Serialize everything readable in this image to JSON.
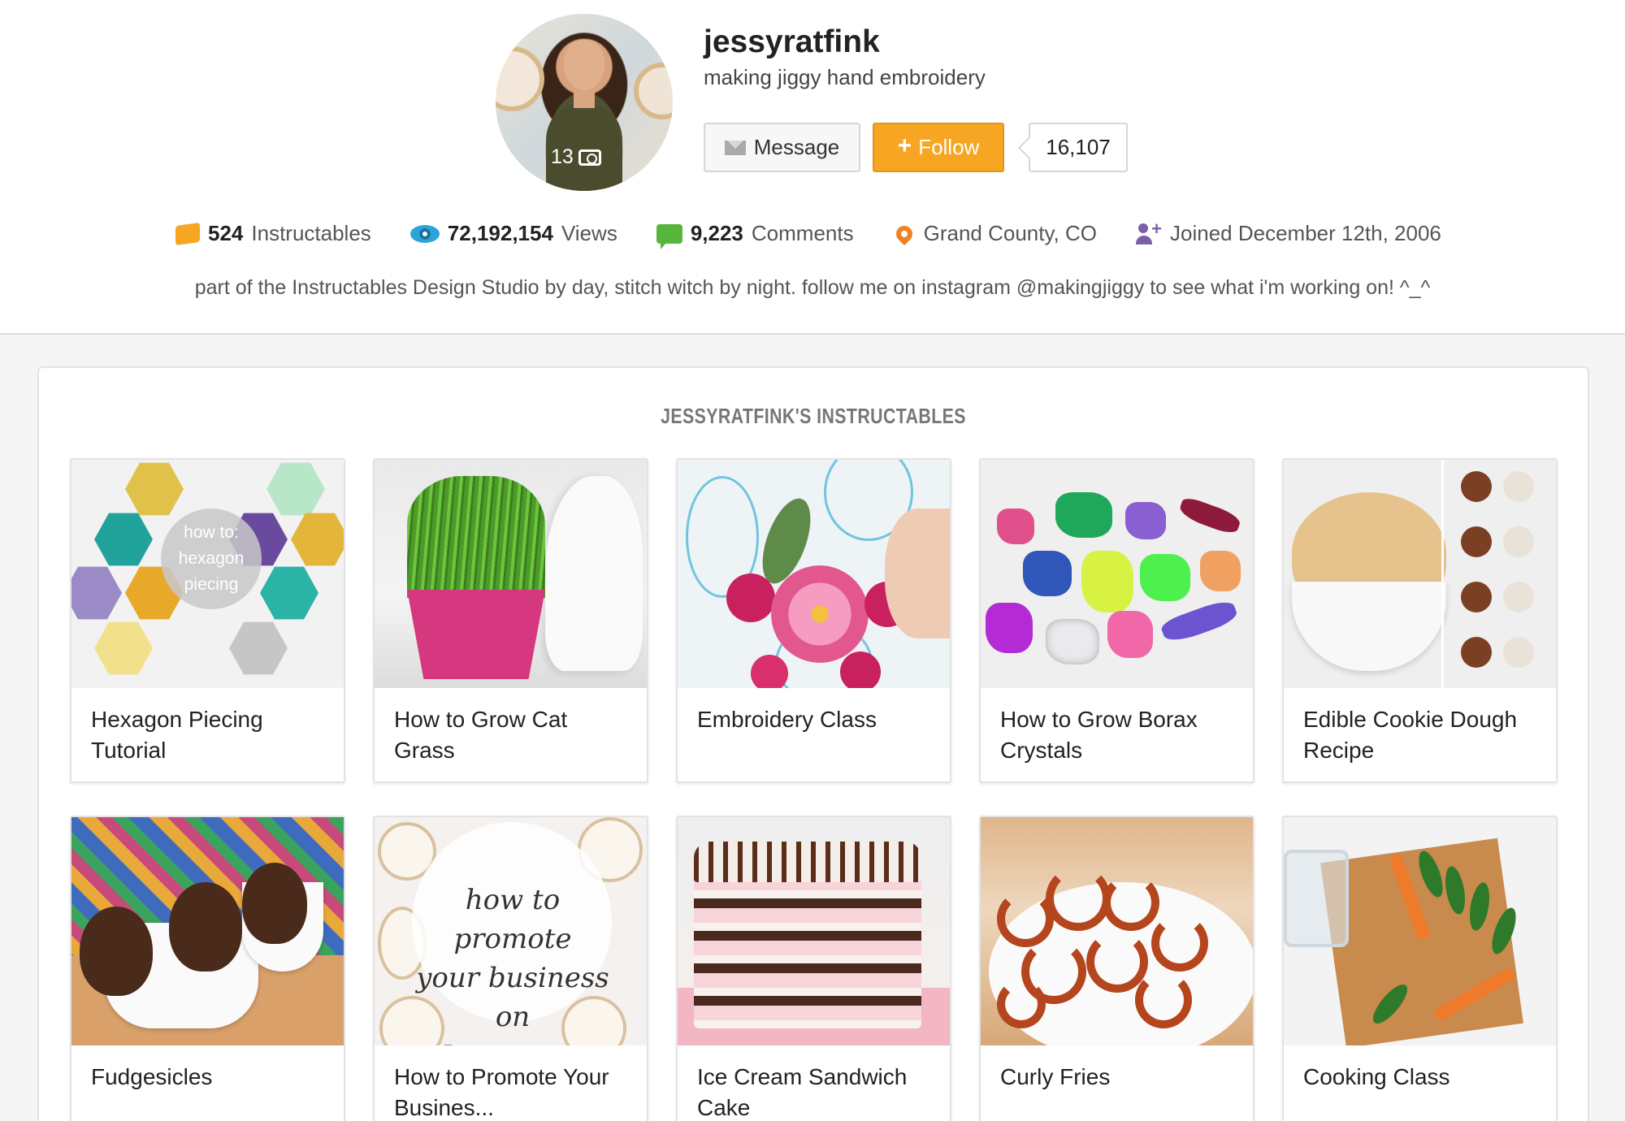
{
  "profile": {
    "username": "jessyratfink",
    "tagline": "making jiggy hand embroidery",
    "avatar_photo_count": "13",
    "message_label": "Message",
    "follow_plus": "+",
    "follow_label": "Follow",
    "follower_count": "16,107",
    "bio": "part of the Instructables Design Studio by day, stitch witch by night. follow me on instagram @makingjiggy to see what i'm working on! ^_^"
  },
  "stats": {
    "instructables_count": "524",
    "instructables_label": "Instructables",
    "views_count": "72,192,154",
    "views_label": "Views",
    "comments_count": "9,223",
    "comments_label": "Comments",
    "location": "Grand County, CO",
    "joined": "Joined December 12th, 2006"
  },
  "instructables": {
    "heading": "JESSYRATFINK'S INSTRUCTABLES",
    "hexagon_overlay": [
      "how to:",
      "hexagon",
      "piecing"
    ],
    "promo_overlay": [
      "how to promote",
      "your business on",
      "Instagram"
    ],
    "items": [
      {
        "title": "Hexagon Piecing Tutorial"
      },
      {
        "title": "How to Grow Cat Grass"
      },
      {
        "title": "Embroidery Class"
      },
      {
        "title": "How to Grow Borax Crystals"
      },
      {
        "title": "Edible Cookie Dough Recipe"
      },
      {
        "title": "Fudgesicles"
      },
      {
        "title": "How to Promote Your Busines..."
      },
      {
        "title": "Ice Cream Sandwich Cake"
      },
      {
        "title": "Curly Fries"
      },
      {
        "title": "Cooking Class"
      }
    ]
  },
  "colors": {
    "follow": "#f6a623",
    "instructables_icon": "#f6a623",
    "views_icon": "#29a5dc",
    "comments_icon": "#58b63c",
    "location_icon": "#f08124",
    "joined_icon": "#7b5ea7"
  }
}
